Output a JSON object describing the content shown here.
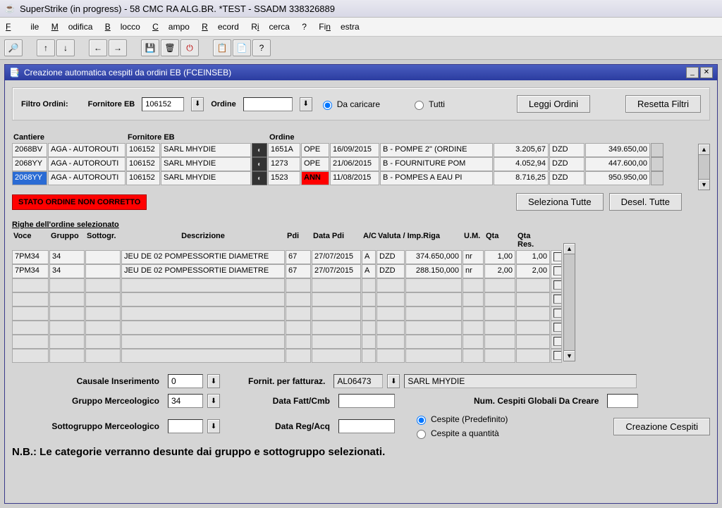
{
  "app_title": "SuperStrike (in progress) - 58 CMC RA ALG.BR. *TEST - SSADM 338326889",
  "menu": {
    "file": "File",
    "modifica": "Modifica",
    "blocco": "Blocco",
    "campo": "Campo",
    "record": "Record",
    "ricerca": "Ricerca",
    "help": "?",
    "finestra": "Finestra"
  },
  "inner_title": "Creazione automatica cespiti da ordini EB (FCEINSEB)",
  "filter": {
    "label": "Filtro Ordini:",
    "fornitore_label": "Fornitore EB",
    "fornitore_value": "106152",
    "ordine_label": "Ordine",
    "ordine_value": "",
    "radio_load": "Da caricare",
    "radio_all": "Tutti",
    "btn_leggi": "Leggi Ordini",
    "btn_reset": "Resetta Filtri"
  },
  "orders_headers": {
    "cantiere": "Cantiere",
    "fornitore": "Fornitore EB",
    "ordine": "Ordine"
  },
  "orders": [
    {
      "cant_code": "2068BV",
      "cant_desc": "AGA - AUTOROUTI",
      "forn_code": "106152",
      "forn_name": "SARL MHYDIE",
      "ord": "1651A",
      "state": "OPE",
      "date": "16/09/2015",
      "desc": "B - POMPE 2\" (ORDINE",
      "amt1": "3.205,67",
      "cur": "DZD",
      "amt2": "349.650,00",
      "sel": false,
      "ann": false
    },
    {
      "cant_code": "2068YY",
      "cant_desc": "AGA - AUTOROUTI",
      "forn_code": "106152",
      "forn_name": "SARL MHYDIE",
      "ord": "1273",
      "state": "OPE",
      "date": "21/06/2015",
      "desc": "B - FOURNITURE POM",
      "amt1": "4.052,94",
      "cur": "DZD",
      "amt2": "447.600,00",
      "sel": false,
      "ann": false
    },
    {
      "cant_code": "2068YY",
      "cant_desc": "AGA - AUTOROUTI",
      "forn_code": "106152",
      "forn_name": "SARL MHYDIE",
      "ord": "1523",
      "state": "ANN",
      "date": "11/08/2015",
      "desc": "B - POMPES A EAU PI",
      "amt1": "8.716,25",
      "cur": "DZD",
      "amt2": "950.950,00",
      "sel": true,
      "ann": true
    }
  ],
  "status_error": "STATO ORDINE NON CORRETTO",
  "btn_sel_all": "Seleziona Tutte",
  "btn_desel_all": "Desel. Tutte",
  "righe_title": "Righe dell'ordine selezionato",
  "righe_headers": {
    "voce": "Voce",
    "gruppo": "Gruppo",
    "sottogr": "Sottogr.",
    "descr": "Descrizione",
    "pdi": "Pdi",
    "datapdi": "Data Pdi",
    "ac": "A/C",
    "valuta": "Valuta / Imp.Riga",
    "um": "U.M.",
    "qta": "Qta",
    "qtares": "Qta Res."
  },
  "righe": [
    {
      "voce": "7PM34",
      "gruppo": "34",
      "sottogr": "",
      "descr": "JEU DE 02 POMPESSORTIE DIAMETRE",
      "pdi": "67",
      "datapdi": "27/07/2015",
      "ac": "A",
      "valuta": "DZD",
      "imp": "374.650,000",
      "um": "nr",
      "qta": "1,00",
      "qtares": "1,00"
    },
    {
      "voce": "7PM34",
      "gruppo": "34",
      "sottogr": "",
      "descr": "JEU DE 02 POMPESSORTIE DIAMETRE",
      "pdi": "67",
      "datapdi": "27/07/2015",
      "ac": "A",
      "valuta": "DZD",
      "imp": "288.150,000",
      "um": "nr",
      "qta": "2,00",
      "qtares": "2,00"
    }
  ],
  "bottom": {
    "causale_label": "Causale Inserimento",
    "causale_value": "0",
    "gruppo_label": "Gruppo Merceologico",
    "gruppo_value": "34",
    "sottogruppo_label": "Sottogruppo Merceologico",
    "sottogruppo_value": "",
    "fornit_label": "Fornit. per fatturaz.",
    "fornit_code": "AL06473",
    "fornit_name": "SARL MHYDIE",
    "datafatt_label": "Data Fatt/Cmb",
    "datafatt_value": "",
    "datareg_label": "Data Reg/Acq",
    "datareg_value": "",
    "numcespiti_label": "Num. Cespiti Globali Da Creare",
    "numcespiti_value": "",
    "radio_pred": "Cespite (Predefinito)",
    "radio_qta": "Cespite a quantità",
    "btn_crea": "Creazione Cespiti"
  },
  "nb_text": "N.B.: Le categorie verranno desunte dai gruppo e sottogruppo selezionati."
}
